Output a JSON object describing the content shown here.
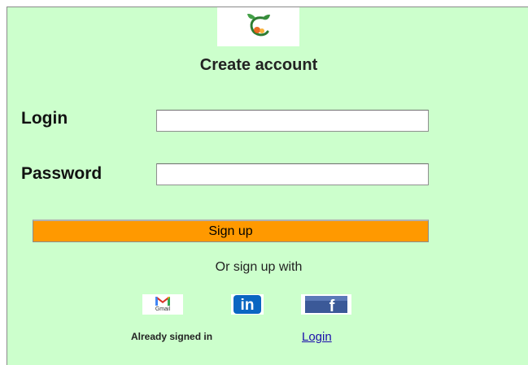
{
  "form": {
    "title": "Create account",
    "login_label": "Login",
    "login_value": "",
    "password_label": "Password",
    "password_value": "",
    "signup_button": "Sign up",
    "or_text": "Or sign up with"
  },
  "social": {
    "gmail_text": "Gmail",
    "linkedin_text": "in",
    "facebook_text": "f"
  },
  "footer": {
    "already_text": "Already signed in",
    "login_link": "Login"
  },
  "colors": {
    "background": "#ccffcc",
    "button": "#ff9900",
    "link": "#1a0dab",
    "linkedin": "#0a66c2",
    "facebook": "#3b5998"
  }
}
